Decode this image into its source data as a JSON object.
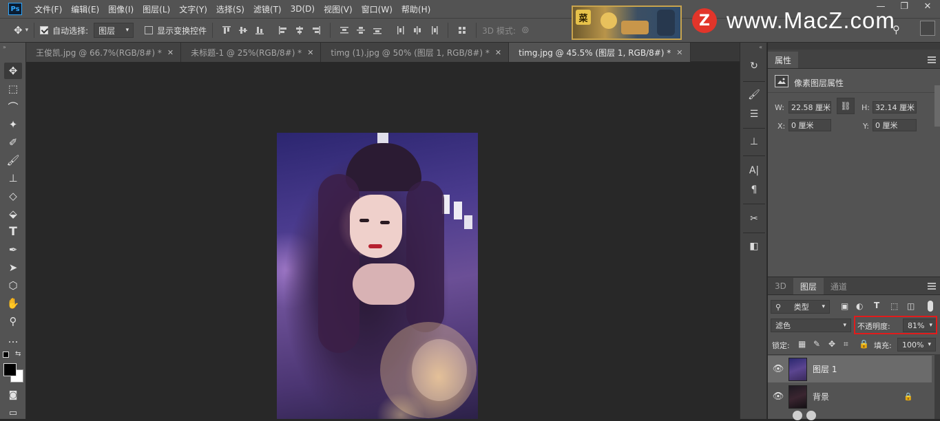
{
  "menubar": {
    "logo": "Ps",
    "items": [
      "文件(F)",
      "编辑(E)",
      "图像(I)",
      "图层(L)",
      "文字(Y)",
      "选择(S)",
      "滤镜(T)",
      "3D(D)",
      "视图(V)",
      "窗口(W)",
      "帮助(H)"
    ]
  },
  "watermark": {
    "badge": "Z",
    "text": "www.MacZ.com"
  },
  "banner": {
    "tag": "菜"
  },
  "window_controls": [
    "—",
    "❐",
    "✕"
  ],
  "options": {
    "auto_select_label": "自动选择:",
    "auto_select_checked": true,
    "auto_select_value": "图层",
    "show_transform_label": "显示变换控件",
    "show_transform_checked": false,
    "mode3d_label": "3D 模式:"
  },
  "tabs": [
    {
      "label": "王俊凯.jpg @ 66.7%(RGB/8#) *",
      "active": false
    },
    {
      "label": "未标题-1 @ 25%(RGB/8#) *",
      "active": false
    },
    {
      "label": "timg (1).jpg @ 50% (图层 1, RGB/8#) *",
      "active": false
    },
    {
      "label": "timg.jpg @ 45.5% (图层 1, RGB/8#) *",
      "active": true
    }
  ],
  "tools": [
    "move-tool",
    "marquee-tool",
    "lasso-tool",
    "magic-wand-tool",
    "eyedropper-tool",
    "brush-tool",
    "stamp-tool",
    "eraser-tool",
    "paint-bucket-tool",
    "type-tool",
    "pen-tool",
    "path-select-tool",
    "shape-tool",
    "hand-tool",
    "zoom-tool",
    "more-tools"
  ],
  "tool_glyphs": [
    "✥",
    "⬚",
    "⌒",
    "✦",
    "✐",
    "🖌",
    "⊥",
    "◇",
    "⬙",
    "T",
    "✒",
    "➤",
    "⬡",
    "✋",
    "⚲",
    "…"
  ],
  "colors": {
    "foreground": "#000000",
    "background": "#ffffff",
    "accent_highlight": "#e21b1b"
  },
  "properties": {
    "tab": "属性",
    "section": "像素图层属性",
    "w_label": "W:",
    "w_value": "22.58 厘米",
    "h_label": "H:",
    "h_value": "32.14 厘米",
    "x_label": "X:",
    "x_value": "0 厘米",
    "y_label": "Y:",
    "y_value": "0 厘米"
  },
  "layers_panel": {
    "tabs": [
      "3D",
      "图层",
      "通道"
    ],
    "active_tab": "图层",
    "filter_label": "类型",
    "blend_mode": "滤色",
    "opacity_label": "不透明度:",
    "opacity_value": "81%",
    "lock_label": "锁定:",
    "fill_label": "填充:",
    "fill_value": "100%",
    "layers": [
      {
        "name": "图层 1",
        "selected": true,
        "locked": false
      },
      {
        "name": "背景",
        "selected": false,
        "locked": true
      }
    ]
  }
}
